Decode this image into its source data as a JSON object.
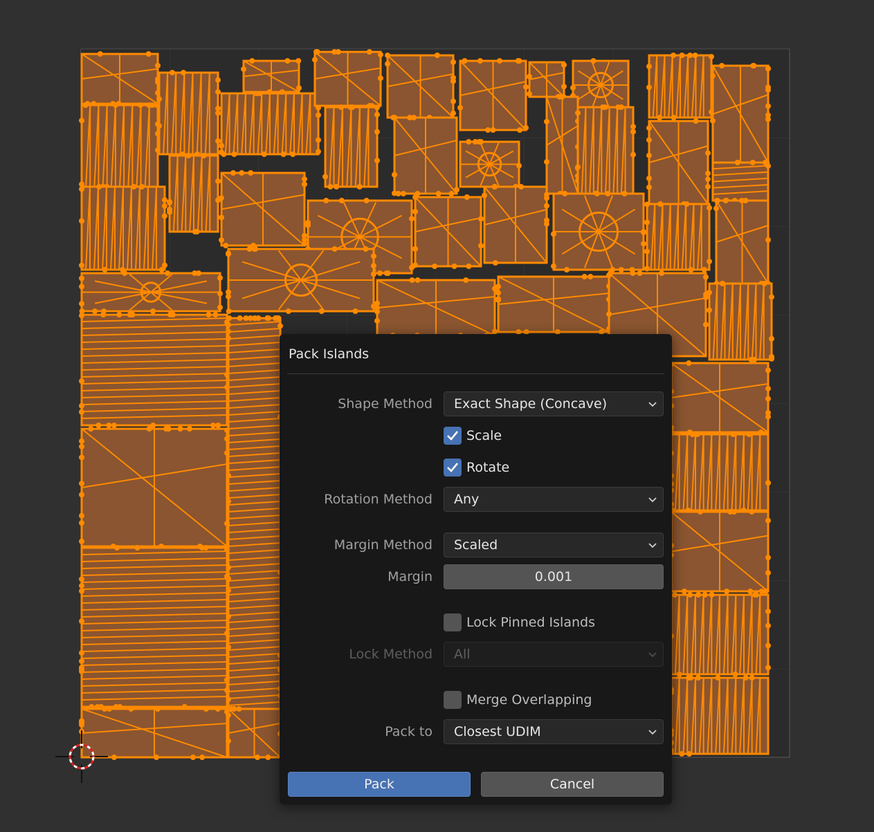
{
  "dialog": {
    "title": "Pack Islands",
    "shape_method": {
      "label": "Shape Method",
      "value": "Exact Shape (Concave)"
    },
    "scale": {
      "label": "Scale",
      "checked": true
    },
    "rotate": {
      "label": "Rotate",
      "checked": true
    },
    "rotation_method": {
      "label": "Rotation Method",
      "value": "Any"
    },
    "margin_method": {
      "label": "Margin Method",
      "value": "Scaled"
    },
    "margin": {
      "label": "Margin",
      "value": "0.001"
    },
    "lock_pinned": {
      "label": "Lock Pinned Islands",
      "checked": false
    },
    "lock_method": {
      "label": "Lock Method",
      "value": "All",
      "disabled": true
    },
    "merge_overlapping": {
      "label": "Merge Overlapping",
      "checked": false
    },
    "pack_to": {
      "label": "Pack to",
      "value": "Closest UDIM"
    },
    "pack_button": "Pack",
    "cancel_button": "Cancel"
  },
  "colors": {
    "background": "#303030",
    "uv_wire": "#ff8a00",
    "uv_face": "#8a5530",
    "accent": "#4772b3"
  },
  "icons": [
    "2d-cursor-icon",
    "checkmark-icon",
    "chevron-down-icon"
  ]
}
